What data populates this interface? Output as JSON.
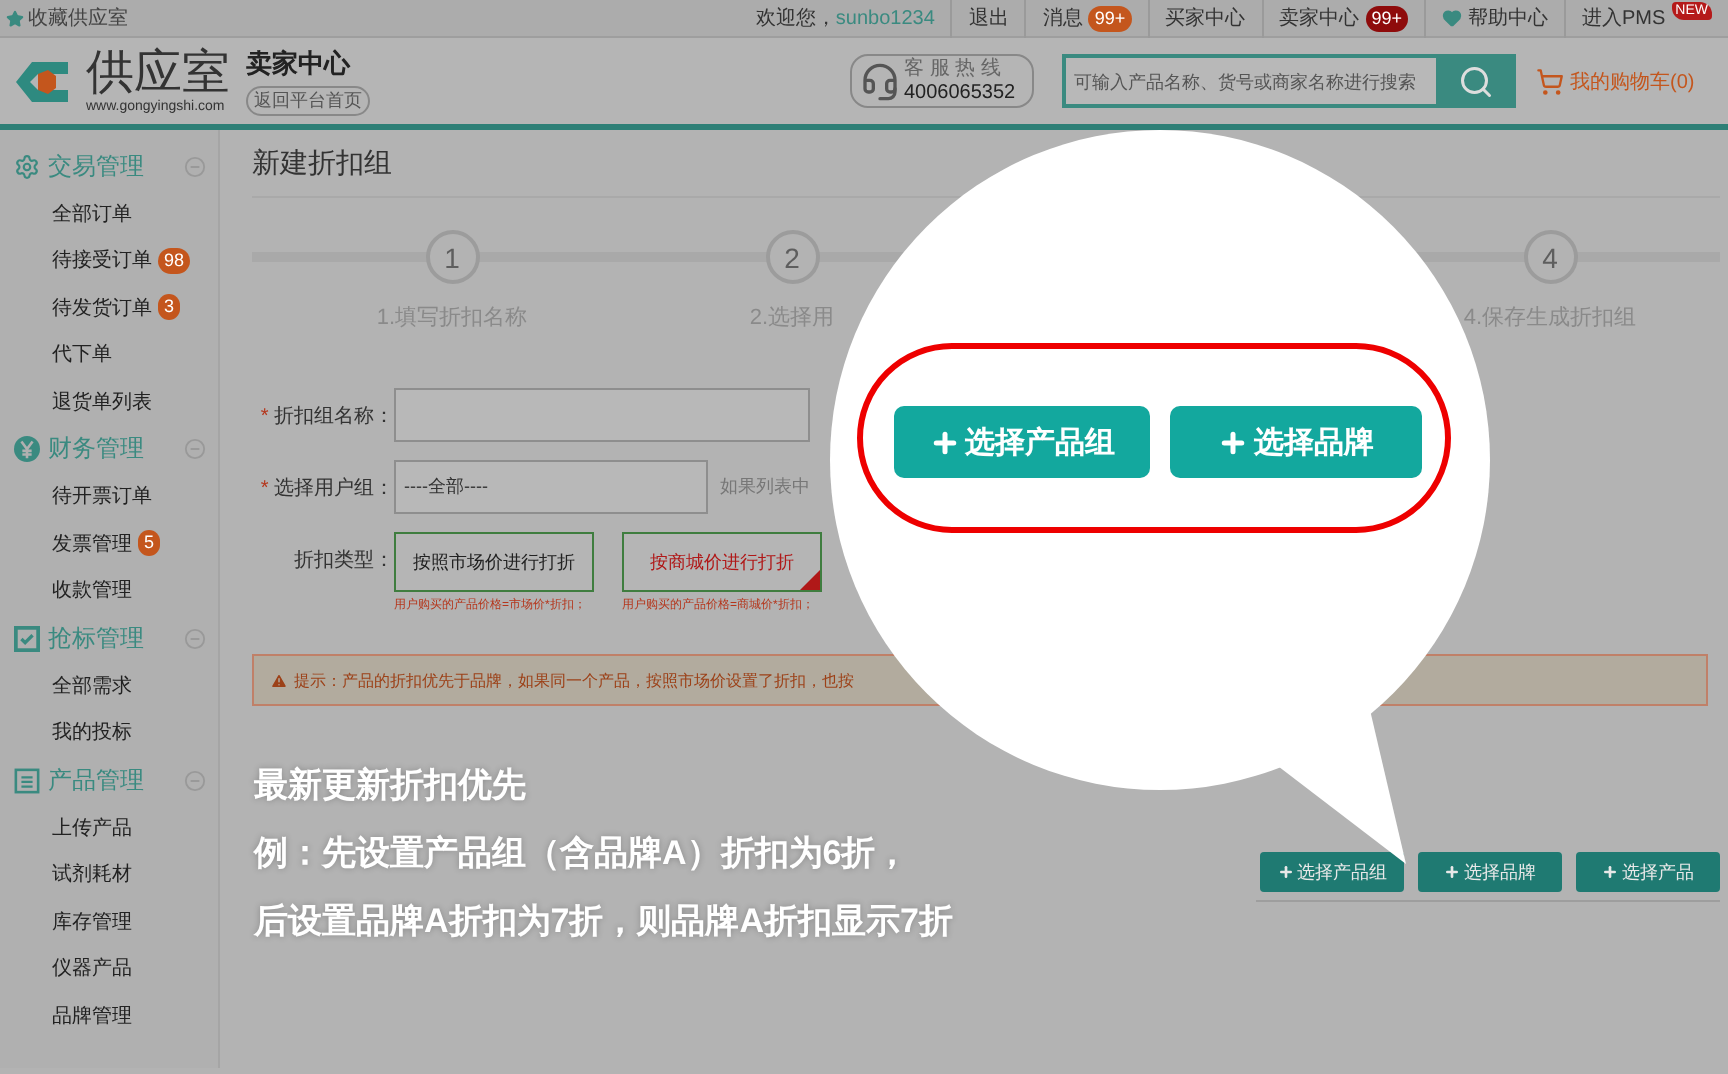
{
  "top_bar": {
    "bookmark": "收藏供应室",
    "welcome": "欢迎您，",
    "username": "sunbo1234",
    "links": [
      {
        "label": "退出"
      },
      {
        "label": "消息",
        "badge": "99+",
        "color": "#c4561d"
      },
      {
        "label": "买家中心"
      },
      {
        "label": "卖家中心",
        "badge": "99+",
        "color": "#8e0b0b"
      },
      {
        "label": "帮助中心"
      },
      {
        "label": "进入PMS",
        "badge": "NEW",
        "color": "#b51a1a"
      }
    ]
  },
  "header": {
    "logo_name": "供应室",
    "logo_url": "www.gongyingshi.com",
    "center_title": "卖家中心",
    "back_link": "返回平台首页",
    "hotline_label": "客 服 热 线",
    "hotline_number": "4006065352",
    "search_placeholder": "可输入产品名称、货号或商家名称进行搜索",
    "cart": "我的购物车(0)"
  },
  "sidebar": {
    "sections": [
      {
        "title": "交易管理",
        "expanded": true,
        "items": [
          {
            "label": "全部订单"
          },
          {
            "label": "待接受订单",
            "badge": "98"
          },
          {
            "label": "待发货订单",
            "badge": "3"
          },
          {
            "label": "代下单"
          },
          {
            "label": "退货单列表"
          }
        ]
      },
      {
        "title": "财务管理",
        "expanded": true,
        "items": [
          {
            "label": "待开票订单"
          },
          {
            "label": "发票管理",
            "badge": "5"
          },
          {
            "label": "收款管理"
          }
        ]
      },
      {
        "title": "抢标管理",
        "expanded": true,
        "items": [
          {
            "label": "全部需求"
          },
          {
            "label": "我的投标"
          }
        ]
      },
      {
        "title": "产品管理",
        "expanded": true,
        "items": [
          {
            "label": "上传产品"
          },
          {
            "label": "试剂耗材"
          },
          {
            "label": "库存管理"
          },
          {
            "label": "仪器产品"
          },
          {
            "label": "品牌管理"
          }
        ]
      }
    ]
  },
  "page_title": "新建折扣组",
  "steps": [
    {
      "number": "1",
      "label": "1.填写折扣名称"
    },
    {
      "number": "2",
      "label": "2.选择用"
    },
    {
      "number": "4",
      "label": "4.保存生成折扣组"
    }
  ],
  "form": {
    "required_mark": "*",
    "name_label": "折扣组名称：",
    "group_label": "选择用户组：",
    "group_value": "----全部----",
    "group_hint": "如果列表中",
    "type_label": "折扣类型：",
    "types": [
      {
        "label": "按照市场价进行打折",
        "note": "用户购买的产品价格=市场价*折扣；",
        "selected": false
      },
      {
        "label": "按商城价进行打折",
        "note": "用户购买的产品价格=商城价*折扣；",
        "selected": true
      }
    ]
  },
  "tip": "提示：产品的折扣优先于品牌，如果同一个产品，按照市场价设置了折扣，也按",
  "bottom_buttons": [
    "选择产品组",
    "选择品牌",
    "选择产品"
  ],
  "callout": {
    "buttons": [
      "选择产品组",
      "选择品牌"
    ]
  },
  "annotation": [
    "最新更新折扣优先",
    "例：先设置产品组（含品牌A）折扣为6折，",
    "后设置品牌A折扣为7折，则品牌A折扣显示7折"
  ]
}
